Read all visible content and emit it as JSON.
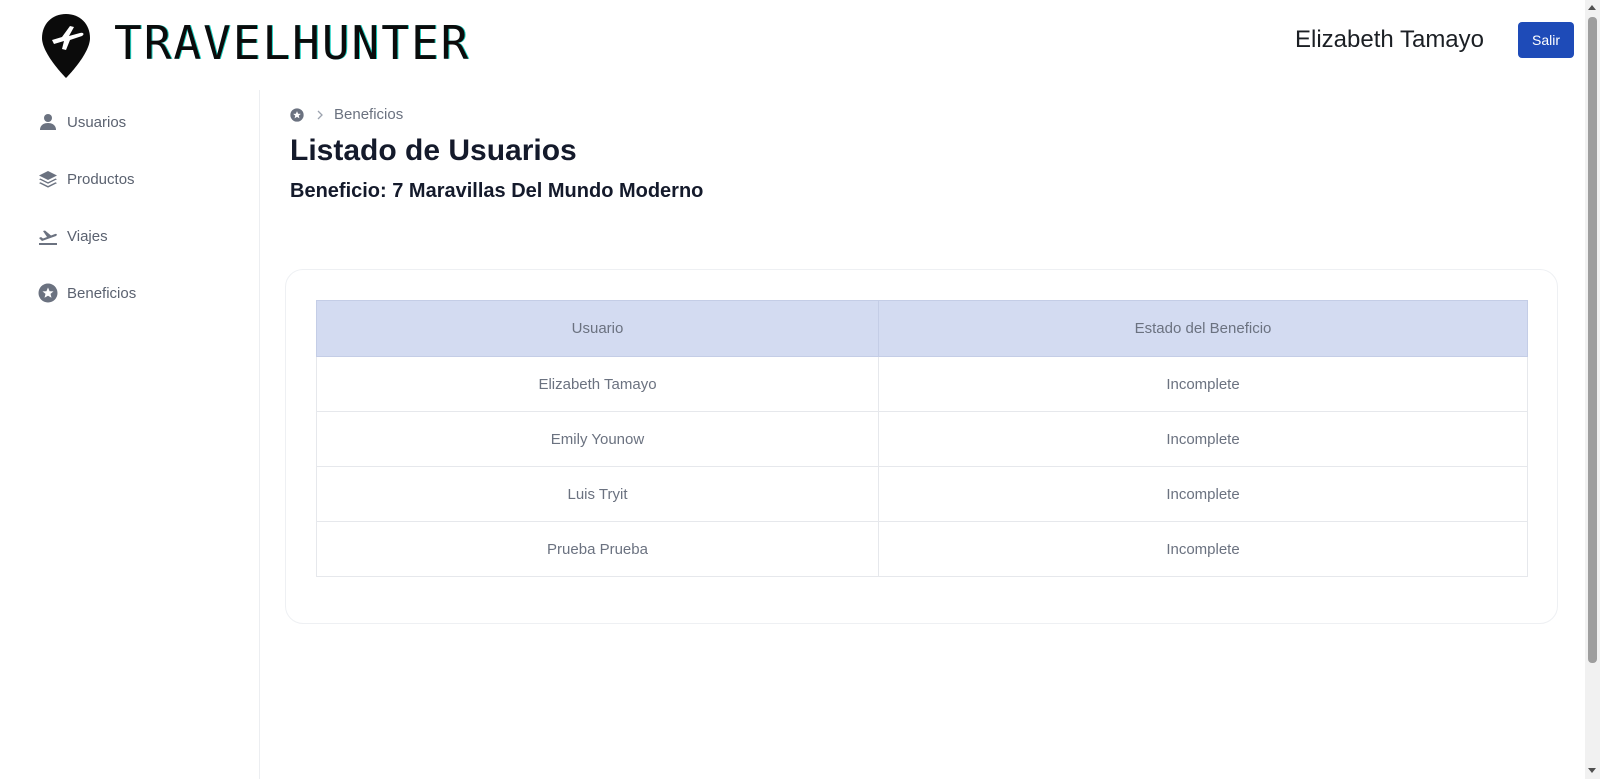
{
  "header": {
    "brand": "TRAVELHUNTER",
    "user_name": "Elizabeth Tamayo",
    "logout_label": "Salir"
  },
  "sidebar": {
    "items": [
      {
        "label": "Usuarios",
        "icon": "user-icon"
      },
      {
        "label": "Productos",
        "icon": "layers-icon"
      },
      {
        "label": "Viajes",
        "icon": "plane-departure-icon"
      },
      {
        "label": "Beneficios",
        "icon": "star-circle-icon"
      }
    ]
  },
  "breadcrumb": {
    "home_icon": "star-circle-icon",
    "current": "Beneficios"
  },
  "main": {
    "title": "Listado de Usuarios",
    "subtitle": "Beneficio: 7 Maravillas Del Mundo Moderno"
  },
  "table": {
    "columns": [
      "Usuario",
      "Estado del Beneficio"
    ],
    "rows": [
      {
        "user": "Elizabeth Tamayo",
        "status": "Incomplete"
      },
      {
        "user": "Emily Younow",
        "status": "Incomplete"
      },
      {
        "user": "Luis Tryit",
        "status": "Incomplete"
      },
      {
        "user": "Prueba Prueba",
        "status": "Incomplete"
      }
    ]
  },
  "colors": {
    "accent": "#1e4bb8",
    "table_header_bg": "#d3dbf1",
    "title": "#141a2b"
  }
}
